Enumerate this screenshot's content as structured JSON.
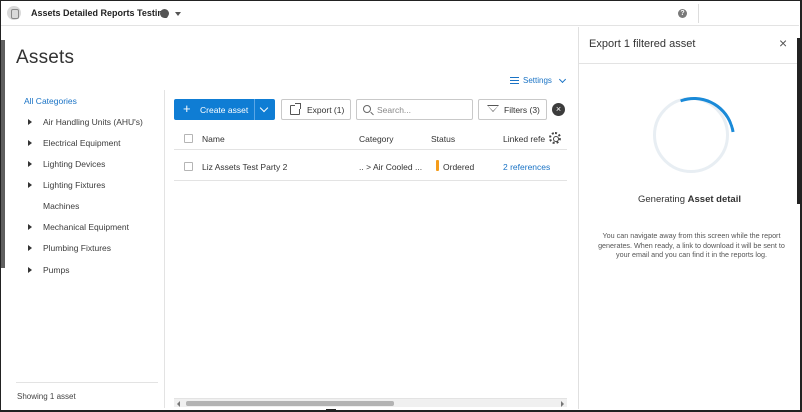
{
  "topbar": {
    "project_title": "Assets Detailed Reports Testing",
    "globe_icon": "globe-icon",
    "help_icon": "help-icon",
    "help_glyph": "?"
  },
  "page": {
    "title": "Assets",
    "settings_label": "Settings"
  },
  "sidebar": {
    "all_categories": "All Categories",
    "items": [
      {
        "label": "Air Handling Units (AHU's)",
        "expandable": true
      },
      {
        "label": "Electrical Equipment",
        "expandable": true
      },
      {
        "label": "Lighting Devices",
        "expandable": true
      },
      {
        "label": "Lighting Fixtures",
        "expandable": true
      },
      {
        "label": "Machines",
        "expandable": false
      },
      {
        "label": "Mechanical Equipment",
        "expandable": true
      },
      {
        "label": "Plumbing Fixtures",
        "expandable": true
      },
      {
        "label": "Pumps",
        "expandable": true
      }
    ],
    "showing": "Showing 1 asset"
  },
  "toolbar": {
    "create_plus": "+",
    "create_label": "Create asset",
    "export_label": "Export (1)",
    "search_placeholder": "Search...",
    "filters_label": "Filters (3)",
    "clear_glyph": "×"
  },
  "table": {
    "columns": [
      "Name",
      "Category",
      "Status",
      "Linked refe"
    ],
    "rows": [
      {
        "name": "Liz Assets Test Party 2",
        "category": ".. > Air Cooled ...",
        "status": "Ordered",
        "linked": "2 references"
      }
    ]
  },
  "export_panel": {
    "title": "Export 1 filtered asset",
    "close_glyph": "×",
    "generating_prefix": "Generating ",
    "generating_bold": "Asset detail",
    "note": "You can navigate away from this screen while the report generates. When ready, a link to download it will be sent to your email and you can find it in the reports log."
  },
  "colors": {
    "accent": "#0f7dd4",
    "link": "#1a73c5",
    "status_ordered": "#f59c1a"
  }
}
